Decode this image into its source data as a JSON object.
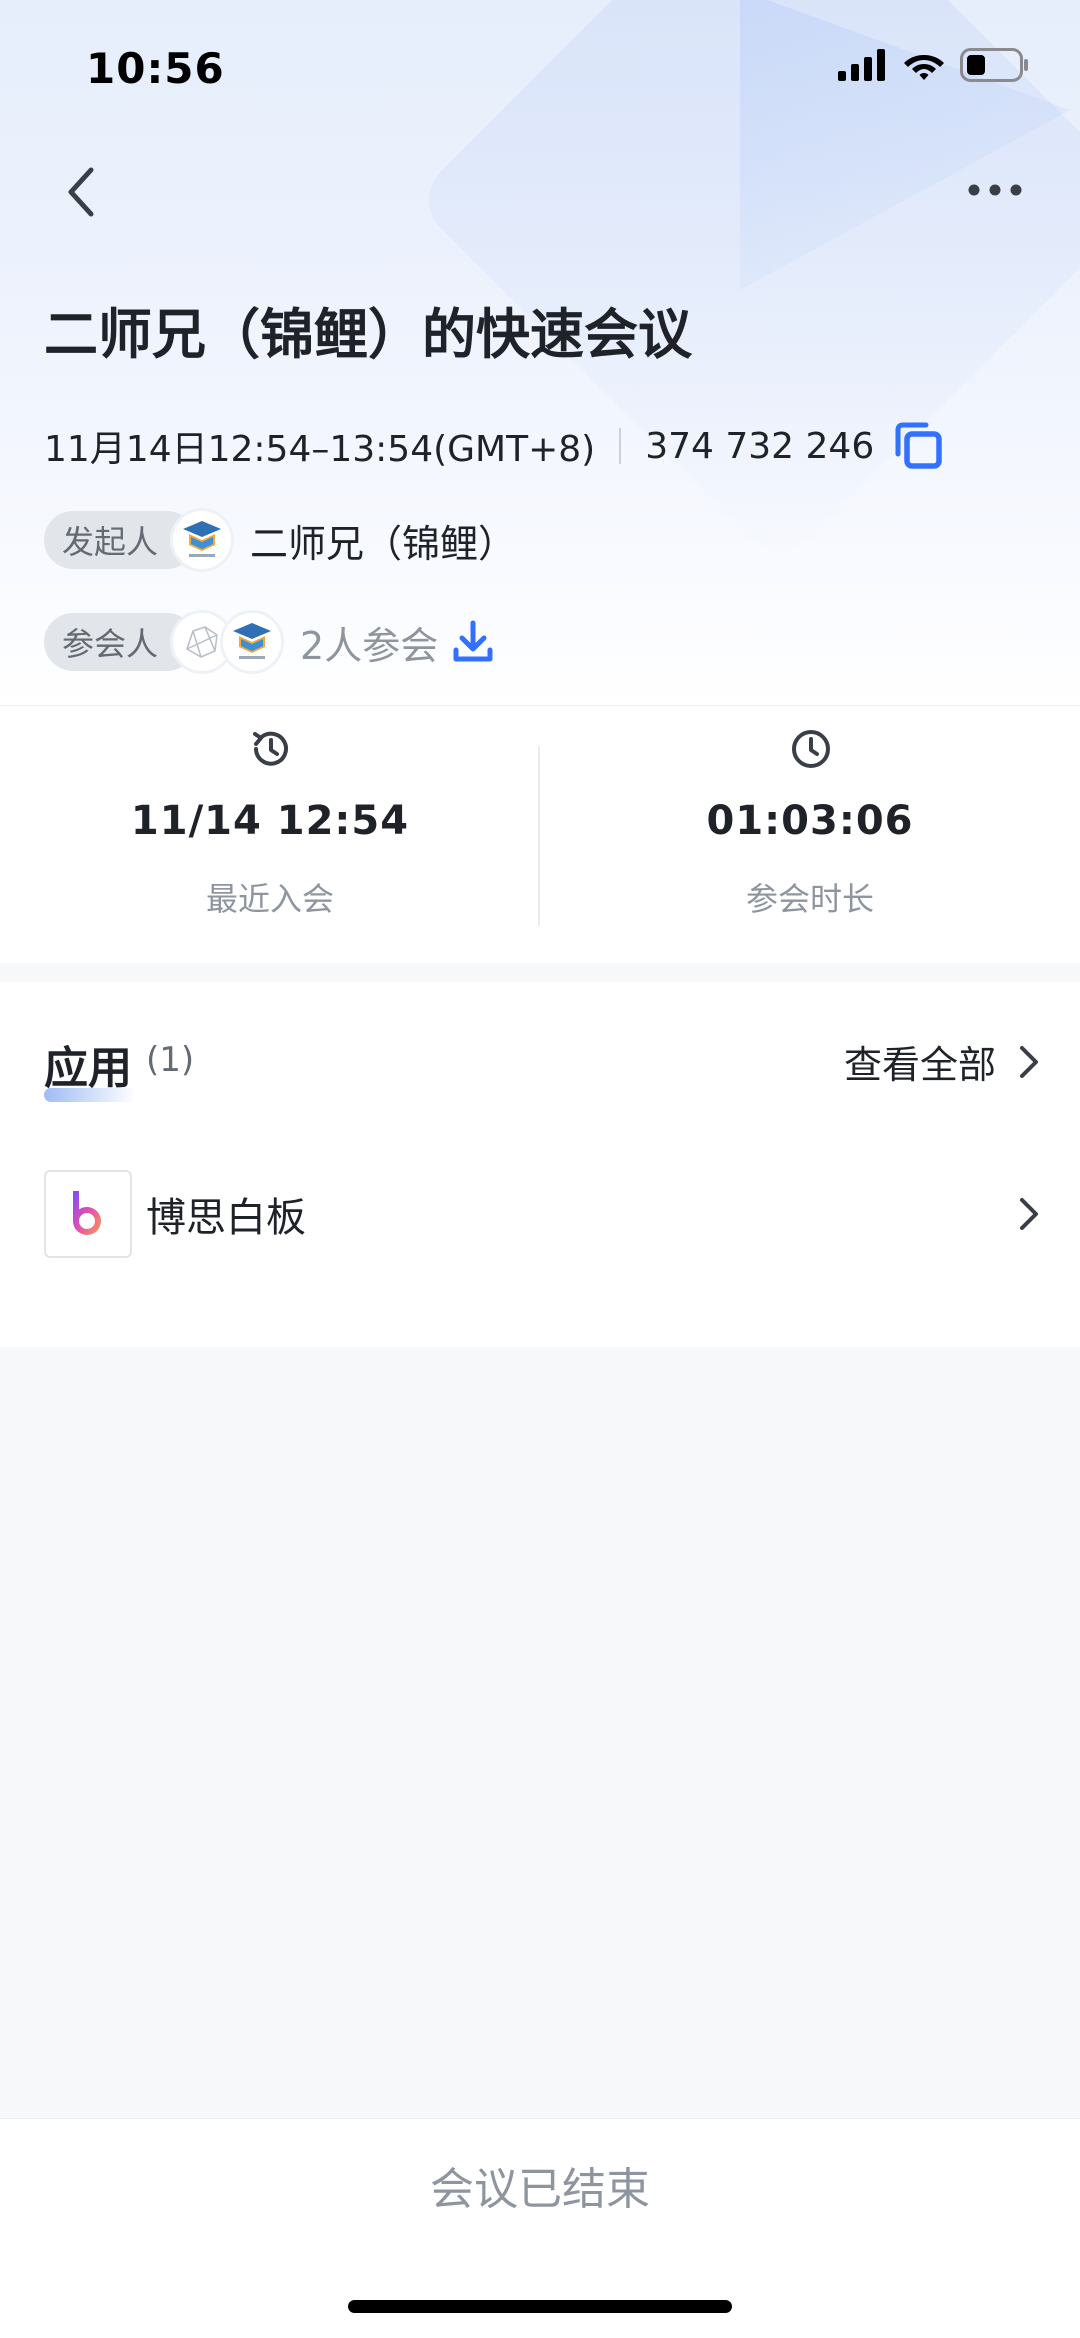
{
  "status_bar": {
    "time": "10:56"
  },
  "meeting": {
    "title": "二师兄（锦鲤）的快速会议",
    "time_range": "11月14日12:54–13:54(GMT+8)",
    "meeting_id": "374 732 246"
  },
  "host": {
    "tag": "发起人",
    "name": "二师兄（锦鲤）"
  },
  "participants": {
    "tag": "参会人",
    "count_text": "2人参会"
  },
  "stats": {
    "last_join": {
      "value": "11/14 12:54",
      "label": "最近入会"
    },
    "duration": {
      "value": "01:03:06",
      "label": "参会时长"
    }
  },
  "apps": {
    "title": "应用",
    "count": "(1)",
    "view_all": "查看全部",
    "items": [
      {
        "name": "博思白板",
        "icon": "boardmix-logo-icon"
      }
    ]
  },
  "footer": {
    "status": "会议已结束"
  },
  "colors": {
    "accent": "#3370ff",
    "muted": "#8f959e",
    "tag_bg": "#e2e5ea"
  }
}
